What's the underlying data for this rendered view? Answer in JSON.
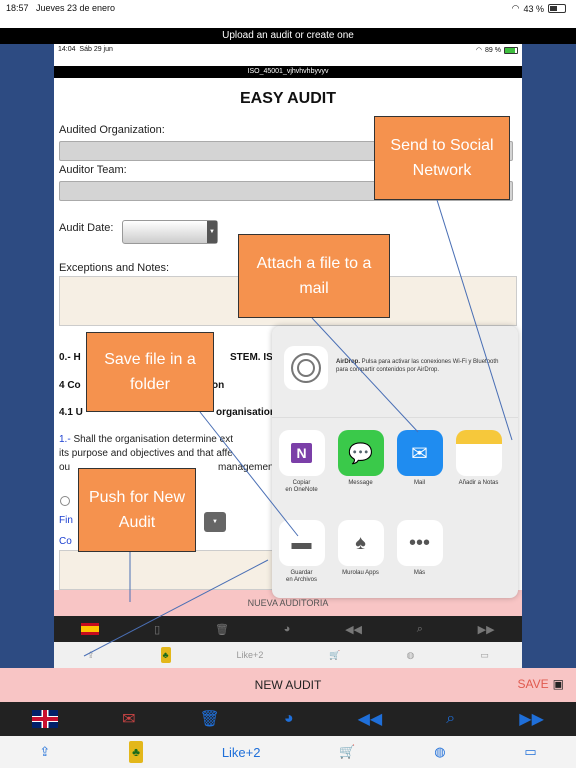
{
  "outer_status": {
    "time": "18:57",
    "date": "Jueves 23 de enero",
    "battery": "43 %"
  },
  "window_title": "Upload an audit or create one",
  "inner_status": {
    "time": "14:04",
    "date": "Sáb 29 jun",
    "battery": "89 %"
  },
  "audit_id": "ISO_45001_vjhvhvhbyvyv",
  "app_title": "EASY AUDIT",
  "form": {
    "audited_org_label": "Audited Organization:",
    "auditor_team_label": "Auditor Team:",
    "audit_date_label": "Audit Date:",
    "notes_label": "Exceptions and Notes:"
  },
  "content": {
    "section0": "0.- H",
    "section0_tail": "STEM. ISO",
    "section4": "4 Co",
    "section4_tail": "on",
    "section41": "4.1 U",
    "section41_tail": "organisation a",
    "q1_num": "1.-",
    "q1_line1": " Shall the organisation determine ext",
    "q1_line2": "its purpose and objectives and that affe",
    "q1_line3": "ou",
    "q1_line3_tail": "management s",
    "fin": "Fin",
    "co": "Co"
  },
  "inner_new_audit": "NUEVA AUDITORIA",
  "share": {
    "airdrop_title": "AirDrop.",
    "airdrop_desc": "Pulsa para activar las conexiones Wi-Fi y Bluetooth para compartir contenidos por AirDrop.",
    "apps": [
      {
        "label": "Copiar\nen OneNote",
        "icon": "onenote-icon"
      },
      {
        "label": "Message",
        "icon": "message-icon"
      },
      {
        "label": "Mail",
        "icon": "mail-icon"
      },
      {
        "label": "Añadir a Notas",
        "icon": "notes-icon"
      }
    ],
    "actions": [
      {
        "label": "Guardar\nen Archivos",
        "icon": "folder-icon"
      },
      {
        "label": "Murolau Apps",
        "icon": "murolau-icon"
      },
      {
        "label": "Más",
        "icon": "more-icon"
      }
    ]
  },
  "callouts": {
    "social": "Send to Social Network",
    "mail": "Attach a file to a mail",
    "folder": "Save file in a folder",
    "new_audit": "Push for New Audit"
  },
  "inner_toolbar_like": "Like+2",
  "outer_new_audit": "NEW AUDIT",
  "save_label": "SAVE",
  "outer_toolbar_like": "Like+2",
  "colors": {
    "accent": "#1f6fd9",
    "callout": "#f5924e",
    "new_audit_bg": "#f8c5c5",
    "save": "#e05a4f"
  }
}
